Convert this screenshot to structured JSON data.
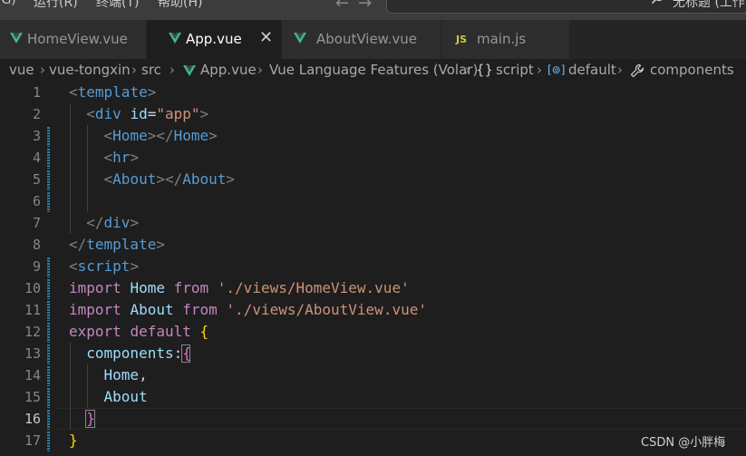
{
  "menu": {
    "items": [
      "(G)",
      "运行(R)",
      "终端(T)",
      "帮助(H)"
    ],
    "window_title": "无标题 (工作"
  },
  "tabs": [
    {
      "label": "HomeView.vue",
      "icon": "vue-icon",
      "active": false
    },
    {
      "label": "App.vue",
      "icon": "vue-icon",
      "active": true
    },
    {
      "label": "AboutView.vue",
      "icon": "vue-icon",
      "active": false
    },
    {
      "label": "main.js",
      "icon": "js-icon",
      "icon_text": "JS",
      "active": false
    }
  ],
  "breadcrumb": [
    "vue",
    "vue-tongxin",
    "src",
    "App.vue",
    "Vue Language Features (Volar)",
    "script",
    "default",
    "components"
  ],
  "breadcrumb_icons": {
    "script": "{}",
    "default": "[⊚]"
  },
  "editor": {
    "current_line": 16,
    "line_numbers": [
      "1",
      "2",
      "3",
      "4",
      "5",
      "6",
      "7",
      "8",
      "9",
      "10",
      "11",
      "12",
      "13",
      "14",
      "15",
      "16",
      "17"
    ],
    "lines": [
      [
        {
          "t": "<",
          "c": "t-punct"
        },
        {
          "t": "template",
          "c": "t-tag"
        },
        {
          "t": ">",
          "c": "t-punct"
        }
      ],
      [
        {
          "t": "  ",
          "c": "t-plain"
        },
        {
          "t": "<",
          "c": "t-punct"
        },
        {
          "t": "div",
          "c": "t-tag"
        },
        {
          "t": " ",
          "c": "t-plain"
        },
        {
          "t": "id",
          "c": "t-attr"
        },
        {
          "t": "=",
          "c": "t-plain"
        },
        {
          "t": "\"app\"",
          "c": "t-str"
        },
        {
          "t": ">",
          "c": "t-punct"
        }
      ],
      [
        {
          "t": "    ",
          "c": "t-plain"
        },
        {
          "t": "<",
          "c": "t-punct"
        },
        {
          "t": "Home",
          "c": "t-tag"
        },
        {
          "t": "></",
          "c": "t-punct"
        },
        {
          "t": "Home",
          "c": "t-tag"
        },
        {
          "t": ">",
          "c": "t-punct"
        }
      ],
      [
        {
          "t": "    ",
          "c": "t-plain"
        },
        {
          "t": "<",
          "c": "t-punct"
        },
        {
          "t": "hr",
          "c": "t-tag"
        },
        {
          "t": ">",
          "c": "t-punct"
        }
      ],
      [
        {
          "t": "    ",
          "c": "t-plain"
        },
        {
          "t": "<",
          "c": "t-punct"
        },
        {
          "t": "About",
          "c": "t-tag"
        },
        {
          "t": "></",
          "c": "t-punct"
        },
        {
          "t": "About",
          "c": "t-tag"
        },
        {
          "t": ">",
          "c": "t-punct"
        }
      ],
      [],
      [
        {
          "t": "  ",
          "c": "t-plain"
        },
        {
          "t": "</",
          "c": "t-punct"
        },
        {
          "t": "div",
          "c": "t-tag"
        },
        {
          "t": ">",
          "c": "t-punct"
        }
      ],
      [
        {
          "t": "</",
          "c": "t-punct"
        },
        {
          "t": "template",
          "c": "t-tag"
        },
        {
          "t": ">",
          "c": "t-punct"
        }
      ],
      [
        {
          "t": "<",
          "c": "t-punct"
        },
        {
          "t": "script",
          "c": "t-tag"
        },
        {
          "t": ">",
          "c": "t-punct"
        }
      ],
      [
        {
          "t": "import",
          "c": "t-kw"
        },
        {
          "t": " ",
          "c": "t-plain"
        },
        {
          "t": "Home",
          "c": "t-var"
        },
        {
          "t": " ",
          "c": "t-plain"
        },
        {
          "t": "from",
          "c": "t-kw"
        },
        {
          "t": " ",
          "c": "t-plain"
        },
        {
          "t": "'./views/HomeView.vue'",
          "c": "t-str"
        }
      ],
      [
        {
          "t": "import",
          "c": "t-kw"
        },
        {
          "t": " ",
          "c": "t-plain"
        },
        {
          "t": "About",
          "c": "t-var"
        },
        {
          "t": " ",
          "c": "t-plain"
        },
        {
          "t": "from",
          "c": "t-kw"
        },
        {
          "t": " ",
          "c": "t-plain"
        },
        {
          "t": "'./views/AboutView.vue'",
          "c": "t-str"
        }
      ],
      [
        {
          "t": "export",
          "c": "t-kw"
        },
        {
          "t": " ",
          "c": "t-plain"
        },
        {
          "t": "default",
          "c": "t-kw"
        },
        {
          "t": " ",
          "c": "t-plain"
        },
        {
          "t": "{",
          "c": "t-brace1"
        }
      ],
      [
        {
          "t": "  ",
          "c": "t-plain"
        },
        {
          "t": "components",
          "c": "t-var"
        },
        {
          "t": ":",
          "c": "t-plain"
        },
        {
          "t": "{",
          "c": "t-brace2"
        }
      ],
      [
        {
          "t": "    ",
          "c": "t-plain"
        },
        {
          "t": "Home",
          "c": "t-var"
        },
        {
          "t": ",",
          "c": "t-plain"
        }
      ],
      [
        {
          "t": "    ",
          "c": "t-plain"
        },
        {
          "t": "About",
          "c": "t-var"
        }
      ],
      [
        {
          "t": "  ",
          "c": "t-plain"
        },
        {
          "t": "}",
          "c": "t-brace2"
        }
      ],
      [
        {
          "t": "}",
          "c": "t-brace1"
        }
      ]
    ],
    "modified_lines": [
      3,
      4,
      5,
      6,
      9,
      10,
      11,
      12,
      13,
      14,
      15,
      16,
      17
    ]
  },
  "watermark": "CSDN @小胖梅",
  "colors": {
    "accent_vue": "#41b883",
    "js": "#cbcb41",
    "modified_gutter": "#1b81a8"
  }
}
